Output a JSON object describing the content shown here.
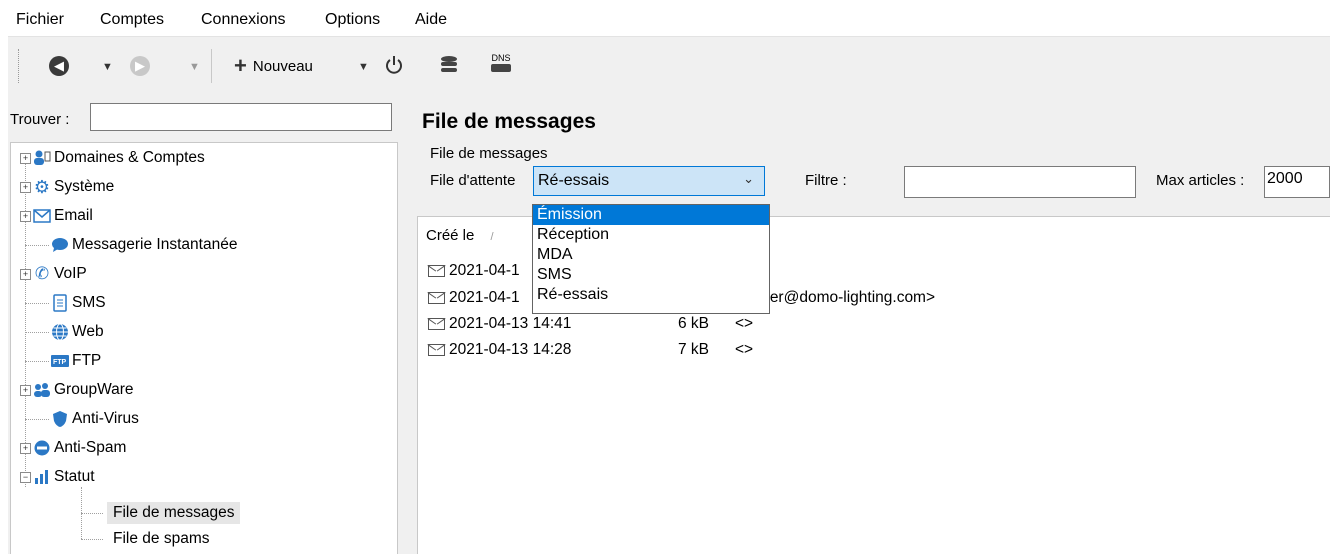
{
  "menu": [
    "Fichier",
    "Comptes",
    "Connexions",
    "Options",
    "Aide"
  ],
  "toolbar": {
    "new_label": "Nouveau",
    "dns_label": "DNS"
  },
  "left": {
    "find_label": "Trouver :",
    "tree": [
      {
        "label": "Domaines & Comptes",
        "icon": "users-icon"
      },
      {
        "label": "Système",
        "icon": "gear-icon"
      },
      {
        "label": "Email",
        "icon": "mail-icon"
      },
      {
        "label": "Messagerie Instantanée",
        "icon": "chat-icon"
      },
      {
        "label": "VoIP",
        "icon": "phone-icon"
      },
      {
        "label": "SMS",
        "icon": "sms-icon"
      },
      {
        "label": "Web",
        "icon": "globe-icon"
      },
      {
        "label": "FTP",
        "icon": "ftp-icon"
      },
      {
        "label": "GroupWare",
        "icon": "group-icon"
      },
      {
        "label": "Anti-Virus",
        "icon": "shield-icon"
      },
      {
        "label": "Anti-Spam",
        "icon": "block-icon"
      },
      {
        "label": "Statut",
        "icon": "chart-icon"
      },
      {
        "label": "File de messages",
        "icon": ""
      },
      {
        "label": "File de spams",
        "icon": ""
      }
    ]
  },
  "right": {
    "title": "File de messages",
    "group_label": "File de messages",
    "queue_label": "File d'attente",
    "queue_value": "Ré-essais",
    "filter_label": "Filtre :",
    "filter_value": "",
    "max_label": "Max articles :",
    "max_value": "2000",
    "col_created": "Créé le",
    "rows": [
      {
        "date": "2021-04-1",
        "size": "",
        "info": ""
      },
      {
        "date": "2021-04-1",
        "size": "",
        "info": "ylder@domo-lighting.com>"
      },
      {
        "date": "2021-04-13 14:41",
        "size": "6 kB",
        "info": "<>"
      },
      {
        "date": "2021-04-13 14:28",
        "size": "7 kB",
        "info": "<>"
      }
    ],
    "dropdown_options": [
      "Émission",
      "Réception",
      "MDA",
      "SMS",
      "Ré-essais"
    ]
  },
  "colors": {
    "accent": "#0078d7",
    "combo_bg": "#cce4f7"
  }
}
